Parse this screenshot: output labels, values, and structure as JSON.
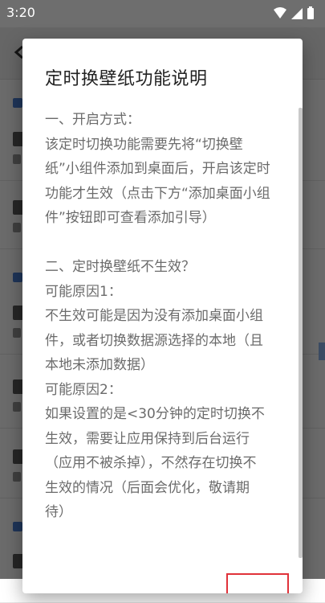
{
  "status_bar": {
    "time": "3:20",
    "icons": [
      "wifi-icon",
      "signal-icon",
      "battery-icon"
    ]
  },
  "dialog": {
    "title": "定时换壁纸功能说明",
    "lines": [
      "一、开启方式：",
      "该定时切换功能需要先将“切换壁",
      "纸”小组件添加到桌面后，开启该定时",
      "功能才生效（点击下方“添加桌面小组",
      "件”按钮即可查看添加引导）",
      "",
      "二、定时换壁纸不生效？",
      "可能原因1：",
      "不生效可能是因为没有添加桌面小组",
      "件，或者切换数据源选择的本地（且",
      "本地未添加数据）",
      "可能原因2：",
      "如果设置的是<30分钟的定时切换不",
      "生效，需要让应用保持到后台运行",
      "（应用不被杀掉），不然存在切换不",
      "生效的情况（后面会优化，敬请期",
      "待）"
    ]
  },
  "colors": {
    "accent": "#4a7fd4",
    "highlight": "#e0323a",
    "scrim": "#000000"
  }
}
